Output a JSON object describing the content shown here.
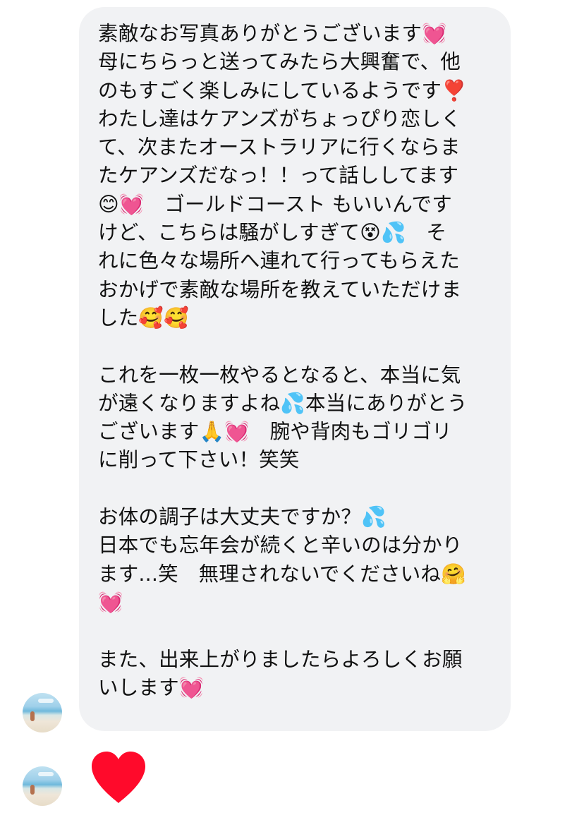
{
  "message": {
    "text": "素敵なお写真ありがとうございます💓\n母にちらっと送ってみたら大興奮で、他\nのもすごく楽しみにしているようです❣️\nわたし達はケアンズがちょっぴり恋しく\nて、次またオーストラリアに行くならま\nたケアンズだなっ！！って話ししてます\n😊💓　ゴールドコースト もいいんです\nけど、こちらは騒がしすぎて😵💦　そ\nれに色々な場所へ連れて行ってもらえた\nおかげで素敵な場所を教えていただけま\nした🥰🥰\n\nこれを一枚一枚やるとなると、本当に気\nが遠くなりますよね💦本当にありがとう\nございます🙏💓　腕や背肉もゴリゴリ\nに削って下さい！笑笑\n\nお体の調子は大丈夫ですか？💦\n日本でも忘年会が続くと辛いのは分かり\nます...笑　無理されないでくださいね🤗\n💓\n\nまた、出来上がりましたらよろしくお願\nいします💓"
  },
  "reaction": {
    "icon": "heart-icon",
    "color": "#ff0a2b"
  },
  "colors": {
    "bubble_background": "#f1f2f4",
    "text": "#111111"
  }
}
